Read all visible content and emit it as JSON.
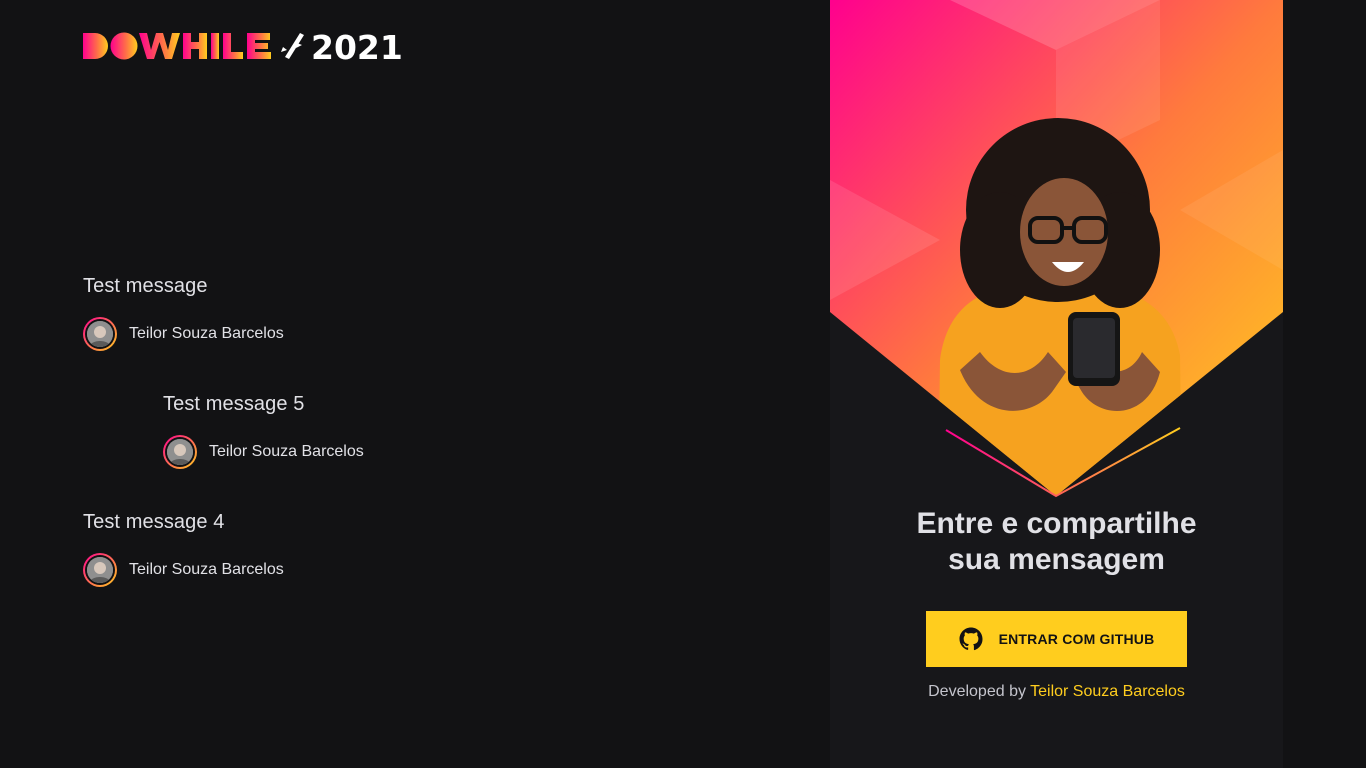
{
  "brand": {
    "logo_text": "DOWHILE 2021"
  },
  "messages": [
    {
      "text": "Test message",
      "author": "Teilor Souza Barcelos"
    },
    {
      "text": "Test message 5",
      "author": "Teilor Souza Barcelos"
    },
    {
      "text": "Test message 4",
      "author": "Teilor Souza Barcelos"
    }
  ],
  "login": {
    "title_line1": "Entre e compartilhe",
    "title_line2": "sua mensagem",
    "button_label": "ENTRAR COM GITHUB",
    "button_icon": "github-icon",
    "credit_prefix": "Developed by",
    "credit_name": "Teilor Souza Barcelos"
  },
  "colors": {
    "background": "#121214",
    "panel": "#17171a",
    "accent_yellow": "#ffcd1e",
    "accent_pink": "#ff008e",
    "text": "#e1e1e6"
  }
}
